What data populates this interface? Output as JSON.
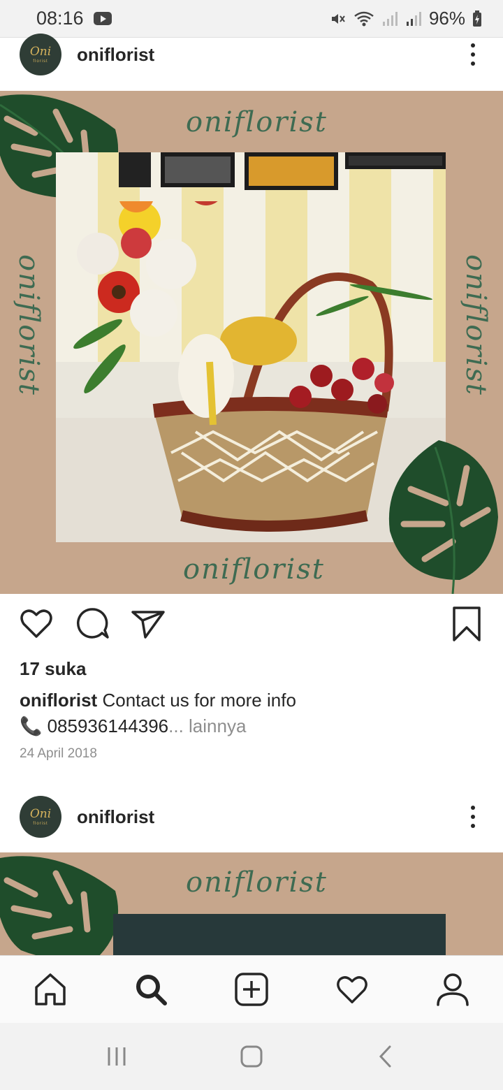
{
  "status_bar": {
    "time": "08:16",
    "battery": "96%"
  },
  "posts": [
    {
      "username": "oniflorist",
      "avatar": {
        "script": "Oni",
        "small": "florist"
      },
      "image": {
        "brand_top": "oniflorist",
        "brand_bottom": "oniflorist",
        "brand_left": "oniflorist",
        "brand_right": "oniflorist"
      },
      "likes": "17 suka",
      "caption_user": "oniflorist",
      "caption_text": "Contact us for more info",
      "caption_line2": "📞 085936144396",
      "caption_ellipsis": "... lainnya",
      "date": "24 April 2018"
    },
    {
      "username": "oniflorist",
      "avatar": {
        "script": "Oni",
        "small": "florist"
      },
      "image": {
        "brand_top": "oniflorist"
      }
    }
  ],
  "icons": {
    "more": "more-vertical-icon",
    "like": "heart-icon",
    "comment": "comment-icon",
    "share": "send-icon",
    "save": "bookmark-icon",
    "home": "home-icon",
    "search": "search-icon",
    "add": "add-post-icon",
    "activity": "heart-icon",
    "profile": "profile-icon"
  },
  "colors": {
    "post_background": "#c6a68c",
    "brand_green": "#3e6b52",
    "text": "#262626",
    "muted": "#8e8e8e"
  }
}
